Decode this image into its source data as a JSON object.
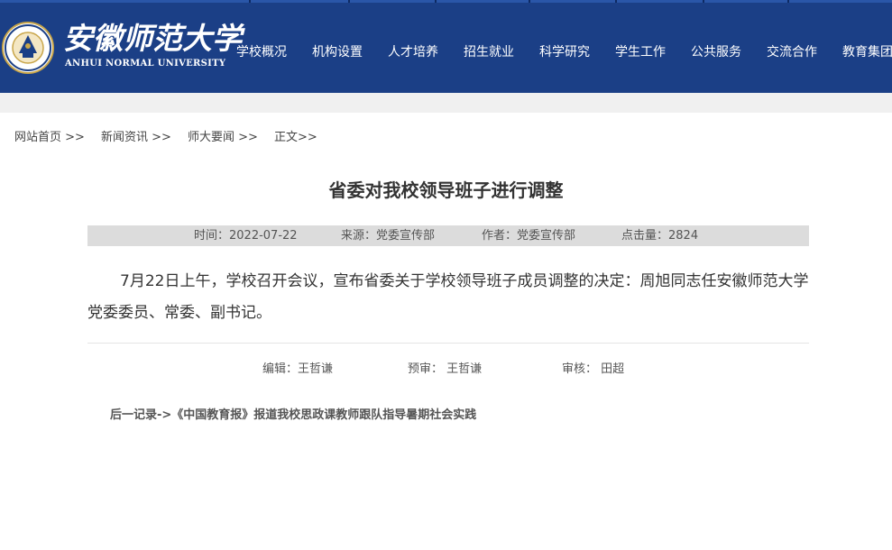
{
  "header": {
    "logo_cn": "安徽师范大学",
    "logo_en": "ANHUI NORMAL UNIVERSITY",
    "nav": [
      "学校概况",
      "机构设置",
      "人才培养",
      "招生就业",
      "科学研究",
      "学生工作",
      "公共服务",
      "交流合作",
      "教育集团"
    ]
  },
  "breadcrumb": [
    "网站首页 >>",
    "新闻资讯 >>",
    "师大要闻 >>",
    "正文>>"
  ],
  "article": {
    "title": "省委对我校领导班子进行调整",
    "meta": {
      "time": "时间：2022-07-22",
      "source": "来源：党委宣传部",
      "author": "作者：党委宣传部",
      "clicks": "点击量：2824"
    },
    "body": "7月22日上午，学校召开会议，宣布省委关于学校领导班子成员调整的决定：周旭同志任安徽师范大学党委委员、常委、副书记。",
    "editor": "编辑：王哲谦",
    "preview": "预审： 王哲谦",
    "review": "审核： 田超"
  },
  "next_record": {
    "label": "后一记录->",
    "link": "《中国教育报》报道我校思政课教师跟队指导暑期社会实践"
  },
  "colors": {
    "header_bg": "#1b3f86",
    "page_bg": "#f0f0f0",
    "meta_bg": "#dcdcdc"
  }
}
